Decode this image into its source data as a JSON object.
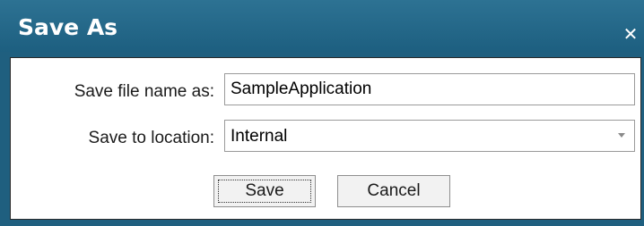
{
  "dialog": {
    "title": "Save As",
    "close_icon": "close-icon"
  },
  "form": {
    "filename_label": "Save file name as:",
    "filename_value": "SampleApplication",
    "location_label": "Save to location:",
    "location_value": "Internal"
  },
  "buttons": {
    "save_label": "Save",
    "cancel_label": "Cancel"
  },
  "colors": {
    "titlebar": "#1d5f80",
    "title_text": "#ffffff",
    "panel_bg": "#ffffff"
  }
}
